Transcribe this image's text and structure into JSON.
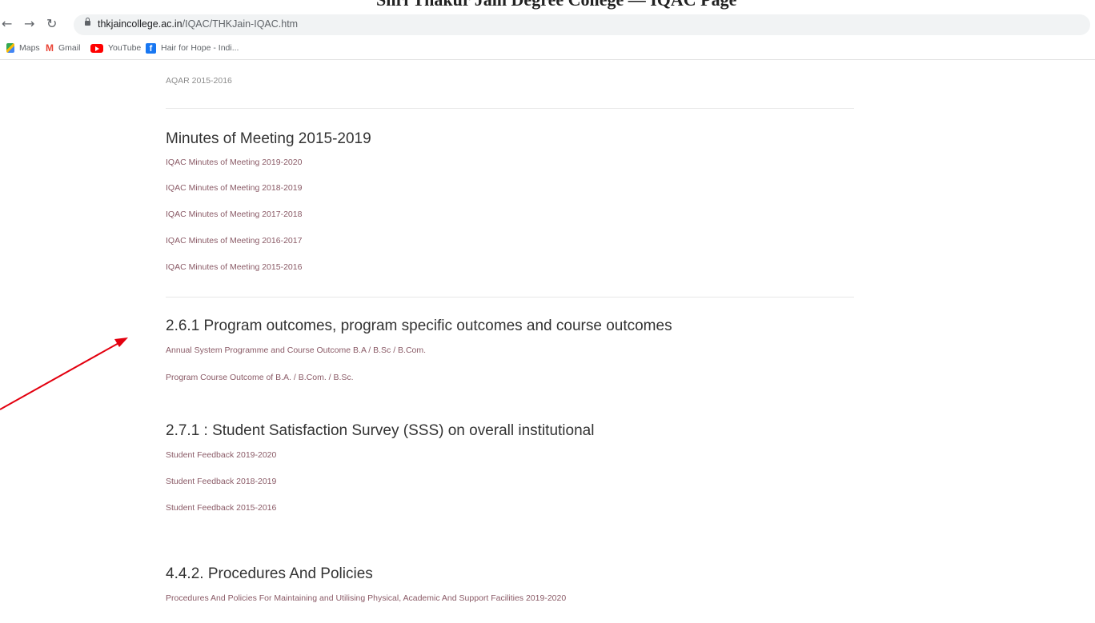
{
  "top_cut_text": "Shri Thakur Jain Degree College — IQAC Page",
  "browser": {
    "back_icon": "back-arrow-icon",
    "forward_icon": "forward-arrow-icon",
    "reload_icon": "reload-icon",
    "url_host": "thkjaincollege.ac.in",
    "url_path": "/IQAC/THKJain-IQAC.htm"
  },
  "bookmarks": [
    {
      "label": "Maps",
      "icon": "maps-icon"
    },
    {
      "label": "Gmail",
      "icon": "gmail-icon"
    },
    {
      "label": "YouTube",
      "icon": "youtube-icon"
    },
    {
      "label": "Hair for Hope - Indi...",
      "icon": "facebook-icon"
    }
  ],
  "content": {
    "top_item": "AQAR 2015-2016",
    "sections": [
      {
        "heading": "Minutes of Meeting 2015-2019",
        "items": [
          "IQAC Minutes of Meeting 2019-2020",
          "IQAC Minutes of Meeting 2018-2019",
          "IQAC Minutes of Meeting 2017-2018",
          "IQAC Minutes of Meeting 2016-2017",
          "IQAC Minutes of Meeting 2015-2016"
        ]
      },
      {
        "heading": "2.6.1 Program outcomes, program specific outcomes and course outcomes",
        "items": [
          "Annual System Programme and Course Outcome B.A / B.Sc / B.Com.",
          "Program Course Outcome of B.A. / B.Com. / B.Sc."
        ]
      },
      {
        "heading": "2.7.1 : Student Satisfaction Survey (SSS) on overall institutional",
        "items": [
          "Student Feedback 2019-2020",
          "Student Feedback 2018-2019",
          "Student Feedback 2015-2016"
        ]
      },
      {
        "heading": "4.4.2. Procedures And Policies",
        "items": [
          "Procedures And Policies For Maintaining and Utilising Physical, Academic And Support Facilities 2019-2020"
        ]
      }
    ]
  },
  "colors": {
    "link": "#8a5a66",
    "heading": "#333333",
    "annotation_arrow": "#e3000f"
  }
}
